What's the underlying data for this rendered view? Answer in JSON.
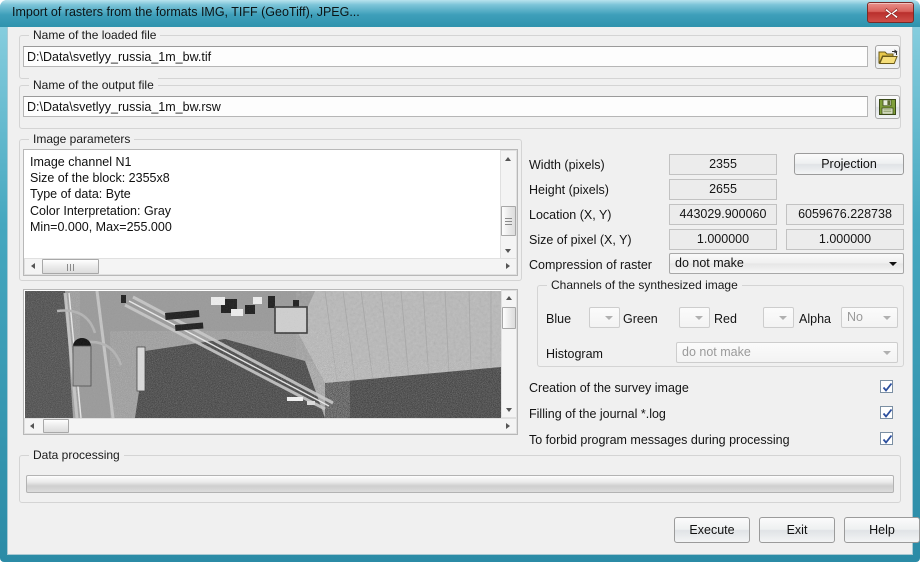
{
  "window": {
    "title": "Import of rasters from the formats IMG, TIFF (GeoTiff), JPEG...",
    "close_icon": "close-icon",
    "accent_color": "#3e9fba",
    "client_bg": "#f0f0f0"
  },
  "loaded_file": {
    "group_label": "Name of the loaded file",
    "value": "D:\\Data\\svetlyy_russia_1m_bw.tif",
    "placeholder": "",
    "browse_icon": "open-folder-icon"
  },
  "output_file": {
    "group_label": "Name of the output file",
    "value": "D:\\Data\\svetlyy_russia_1m_bw.rsw",
    "placeholder": "",
    "save_icon": "floppy-disk-save-icon"
  },
  "image_parameters": {
    "group_label": "Image parameters",
    "lines": [
      "Image channel N1",
      "Size of the block: 2355x8",
      "Type of data: Byte",
      "Color Interpretation: Gray",
      "Min=0.000, Max=255.000"
    ]
  },
  "raster_info": {
    "width_label": "Width (pixels)",
    "width_value": "2355",
    "height_label": "Height (pixels)",
    "height_value": "2655",
    "location_label": "Location (X, Y)",
    "location_x": "443029.900060",
    "location_y": "6059676.228738",
    "pixel_size_label": "Size of pixel (X, Y)",
    "pixel_size_x": "1.000000",
    "pixel_size_y": "1.000000",
    "compression_label": "Compression of raster",
    "compression_value": "do not make",
    "projection_button": "Projection"
  },
  "channels": {
    "group_label": "Channels of the synthesized image",
    "blue_label": "Blue",
    "blue_value": "",
    "green_label": "Green",
    "green_value": "",
    "red_label": "Red",
    "red_value": "",
    "alpha_label": "Alpha",
    "alpha_value": "No",
    "histogram_label": "Histogram",
    "histogram_value": "do not make"
  },
  "options": [
    {
      "label": "Creation of the survey image",
      "checked": true
    },
    {
      "label": "Filling of the journal *.log",
      "checked": true
    },
    {
      "label": "To forbid program messages during processing",
      "checked": true
    }
  ],
  "data_processing": {
    "group_label": "Data processing",
    "progress_percent": 0
  },
  "footer": {
    "execute": "Execute",
    "exit": "Exit",
    "help": "Help"
  }
}
